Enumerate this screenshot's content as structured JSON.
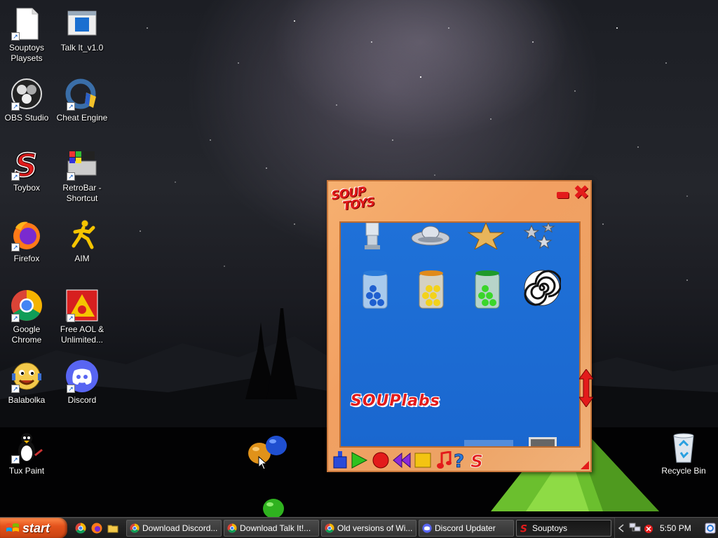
{
  "desktop": {
    "icons": [
      {
        "label": "Souptoys Playsets"
      },
      {
        "label": "Talk It_v1.0"
      },
      {
        "label": "OBS Studio"
      },
      {
        "label": "Cheat Engine"
      },
      {
        "label": "Toybox"
      },
      {
        "label": "RetroBar - Shortcut"
      },
      {
        "label": "Firefox"
      },
      {
        "label": "AIM"
      },
      {
        "label": "Google Chrome"
      },
      {
        "label": "Free AOL & Unlimited..."
      },
      {
        "label": "Balabolka"
      },
      {
        "label": "Discord"
      },
      {
        "label": "Tux Paint"
      },
      {
        "label": "Recycle Bin"
      }
    ]
  },
  "souptoys_window": {
    "logo_line1": "SOUP",
    "logo_line2": "TOYS",
    "watermark": "SOUPlabs",
    "toys": [
      "robot-toy",
      "ufo-toy",
      "gold-star-toy",
      "small-stars-toy",
      "blue-marbles-jar",
      "yellow-marbles-jar",
      "green-marbles-jar",
      "spiral-disc-toy"
    ]
  },
  "taskbar": {
    "start_label": "start",
    "tasks": [
      {
        "label": "Download Discord..."
      },
      {
        "label": "Download Talk It!..."
      },
      {
        "label": "Old versions of Wi..."
      },
      {
        "label": "Discord Updater"
      },
      {
        "label": "Souptoys"
      }
    ],
    "clock": "5:50 PM"
  },
  "colors": {
    "souptoys_red": "#e31b1b",
    "playfield_blue": "#1f71d8",
    "window_orange": "#f2a062",
    "start_orange": "#e4531c"
  }
}
